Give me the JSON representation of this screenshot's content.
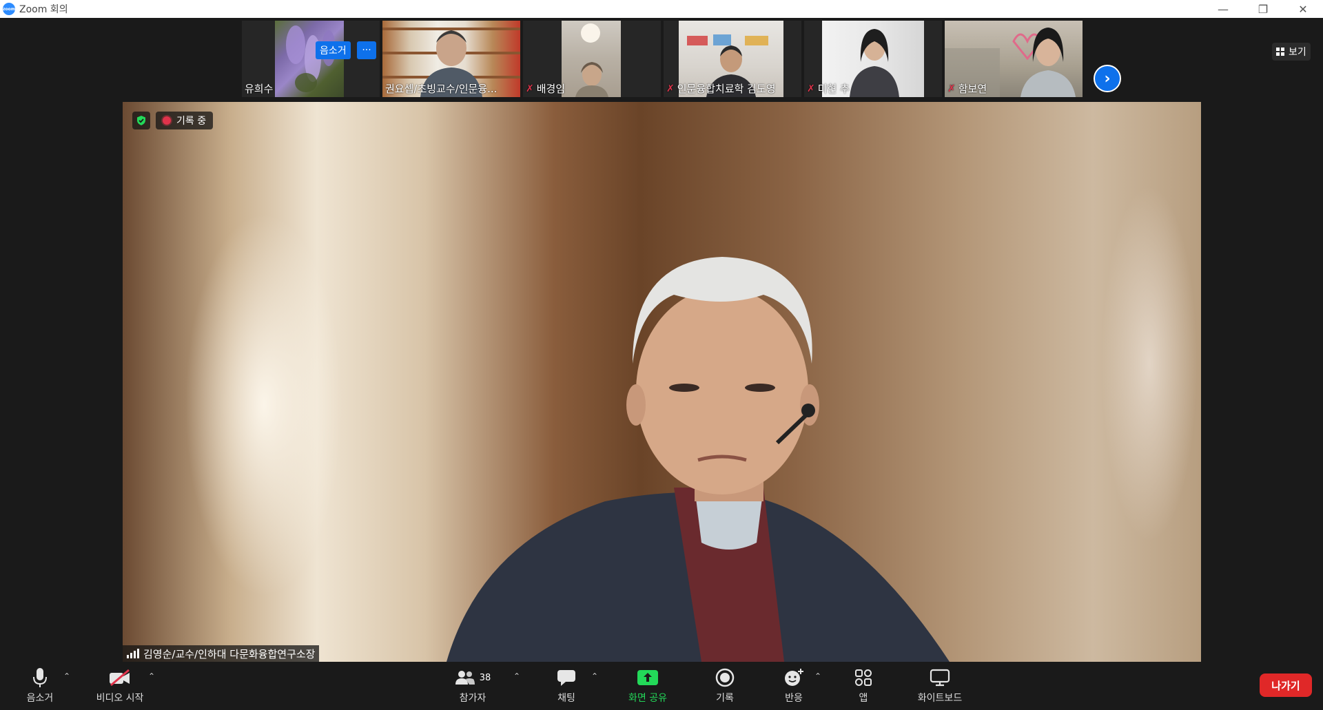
{
  "window": {
    "title": "Zoom 회의",
    "logo_text": "zoom",
    "controls": {
      "minimize": "—",
      "restore": "❐",
      "close": "✕"
    }
  },
  "gallery": {
    "tiles": [
      {
        "name": "유희수",
        "muted": false
      },
      {
        "name": "권요셉/초빙교수/인문융...",
        "muted": false
      },
      {
        "name": "배경임",
        "muted": true
      },
      {
        "name": "인문융합치료학 김도영",
        "muted": true
      },
      {
        "name": "미현 추",
        "muted": true
      },
      {
        "name": "함보연",
        "muted": true
      }
    ],
    "hover_unmute_label": "음소거",
    "hover_more_label": "···",
    "next_label": "›",
    "view_label": "보기"
  },
  "speaker": {
    "name": "김영순/교수/인하대 다문화융합연구소장",
    "recording_label": "기록 중"
  },
  "toolbar": {
    "mute": "음소거",
    "video": "비디오 시작",
    "participants": "참가자",
    "participants_count": "38",
    "chat": "채팅",
    "share": "화면 공유",
    "record": "기록",
    "reactions": "반응",
    "apps": "앱",
    "whiteboard": "화이트보드",
    "leave": "나가기"
  },
  "colors": {
    "accent": "#0e71eb",
    "leave": "#e02828",
    "share": "#23d959",
    "muted": "#e0334b",
    "background": "#1a1a1a"
  }
}
